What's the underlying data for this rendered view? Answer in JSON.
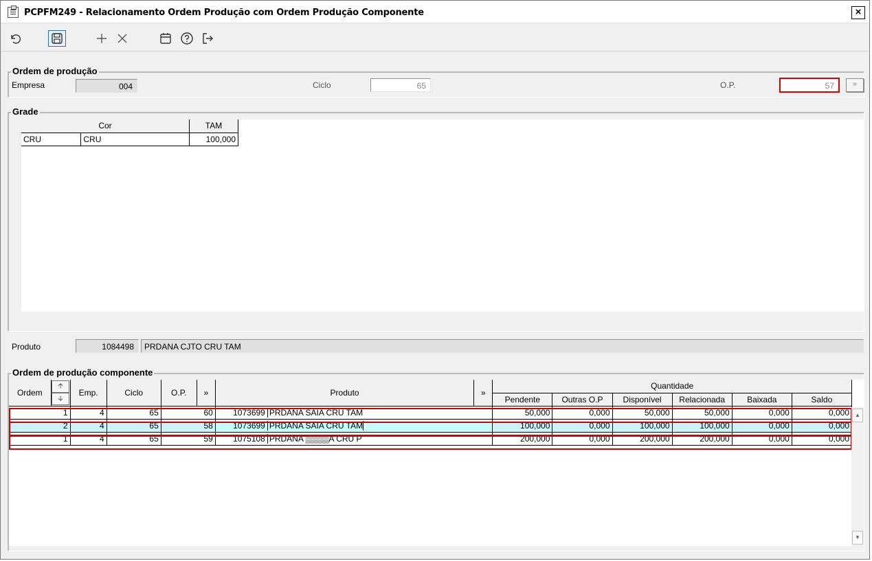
{
  "window": {
    "title": "PCPFM249 - Relacionamento Ordem Produção com Ordem Produção Componente",
    "close": "×"
  },
  "toolbar": {
    "undo": "Desfazer",
    "save": "Salvar",
    "add": "Inserir",
    "delete": "Excluir",
    "calendar": "Calendário",
    "help": "Ajuda",
    "exit": "Sair"
  },
  "ordem": {
    "title": "Ordem de produção",
    "empresa_label": "Empresa",
    "empresa_value": "004",
    "ciclo_label": "Ciclo",
    "ciclo_value": "65",
    "op_label": "O.P.",
    "op_value": "57"
  },
  "grade": {
    "title": "Grade",
    "headers": {
      "cor": "Cor",
      "tam": "TAM"
    },
    "rows": [
      {
        "cod": "CRU",
        "desc": "CRU",
        "tam": "100,000"
      }
    ]
  },
  "produto": {
    "label": "Produto",
    "code": "1084498",
    "desc": "PRDANA CJTO CRU TAM"
  },
  "componente": {
    "title": "Ordem de produção componente",
    "headers": {
      "ordem": "Ordem",
      "emp": "Emp.",
      "ciclo": "Ciclo",
      "op": "O.P.",
      "expand": "»",
      "produto": "Produto",
      "expand2": "»",
      "quantidade": "Quantidade",
      "pendente": "Pendente",
      "outras": "Outras O.P",
      "disponivel": "Disponível",
      "relacionada": "Relacionada",
      "baixada": "Baixada",
      "saldo": "Saldo"
    },
    "rows": [
      {
        "ordem": "1",
        "emp": "4",
        "ciclo": "65",
        "op": "60",
        "code": "1073699",
        "desc": "PRDANA SAIA CRU TAM",
        "pendente": "50,000",
        "outras": "0,000",
        "disponivel": "50,000",
        "relacionada": "50,000",
        "baixada": "0,000",
        "saldo": "0,000"
      },
      {
        "ordem": "2",
        "emp": "4",
        "ciclo": "65",
        "op": "58",
        "code": "1073699",
        "desc": "PRDANA SAIA CRU TAM",
        "pendente": "100,000",
        "outras": "0,000",
        "disponivel": "100,000",
        "relacionada": "100,000",
        "baixada": "0,000",
        "saldo": "0,000"
      },
      {
        "ordem": "1",
        "emp": "4",
        "ciclo": "65",
        "op": "59",
        "code": "1075108",
        "desc": "PRDANA ▒▒▒▒A CRU P",
        "pendente": "200,000",
        "outras": "0,000",
        "disponivel": "200,000",
        "relacionada": "200,000",
        "baixada": "0,000",
        "saldo": "0,000"
      }
    ]
  },
  "colors": {
    "highlight": "#c8fcfc",
    "selected_row": "#ccf2fa",
    "alert": "#d40000"
  }
}
